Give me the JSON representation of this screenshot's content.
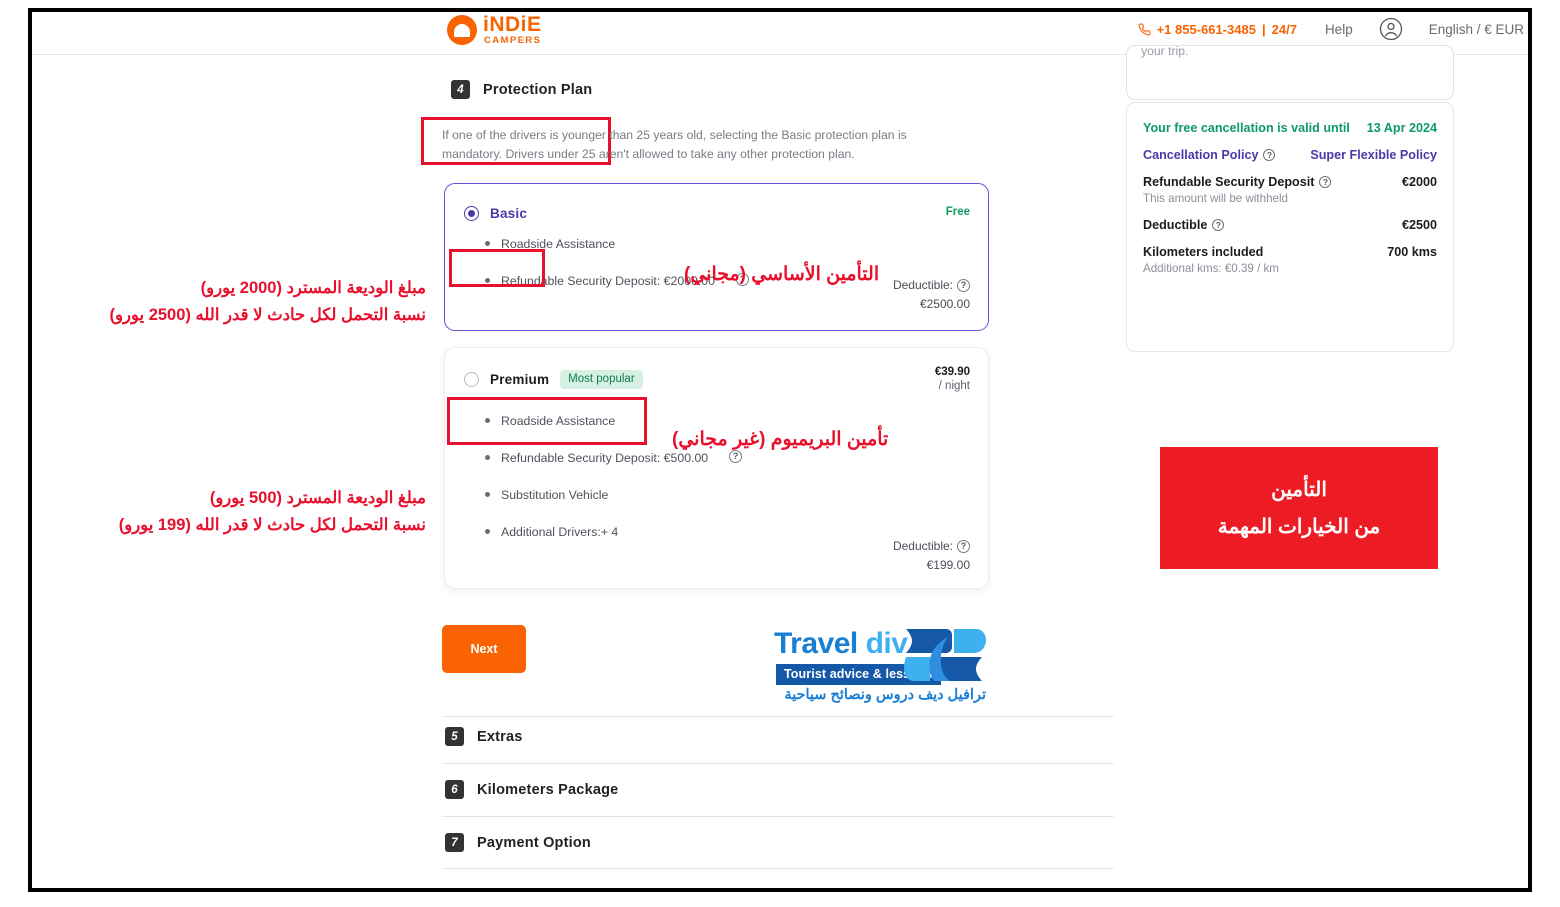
{
  "header": {
    "logo_text": "iNDiE",
    "logo_sub": "CAMPERS",
    "phone": "+1 855-661-3485",
    "phone_sep": "|",
    "phone_hours": "24/7",
    "help": "Help",
    "language": "English / € EUR"
  },
  "protection": {
    "step_number": "4",
    "title": "Protection Plan",
    "description": "If one of the drivers is younger than 25 years old, selecting the Basic protection plan is mandatory. Drivers under 25 aren't allowed to take any other protection plan.",
    "basic": {
      "name": "Basic",
      "price": "Free",
      "features": [
        "Roadside Assistance",
        "Refundable Security Deposit: €2000.00"
      ],
      "deductible_label": "Deductible:",
      "deductible_value": "€2500.00"
    },
    "premium": {
      "name": "Premium",
      "badge": "Most popular",
      "price": "€39.90",
      "price_unit": "/ night",
      "features": [
        "Roadside Assistance",
        "Refundable Security Deposit: €500.00",
        "Substitution Vehicle",
        "Additional Drivers:+ 4"
      ],
      "deductible_label": "Deductible:",
      "deductible_value": "€199.00"
    }
  },
  "next_button": "Next",
  "travel_div": {
    "word_1": "Travel",
    "word_2": "div",
    "tagline": "Tourist advice & lessons",
    "tagline_ar": "ترافيل ديف  دروس ونصائح سياحية"
  },
  "steps": [
    {
      "number": "5",
      "title": "Extras"
    },
    {
      "number": "6",
      "title": "Kilometers Package"
    },
    {
      "number": "7",
      "title": "Payment Option"
    }
  ],
  "sidebar": {
    "partial_text": "your trip.",
    "cancellation_label": "Your free cancellation is valid until",
    "cancellation_date": "13 Apr 2024",
    "policy_label": "Cancellation Policy",
    "policy_value": "Super Flexible Policy",
    "deposit_label": "Refundable Security Deposit",
    "deposit_value": "€2000",
    "deposit_sub": "This amount will be withheld",
    "deductible_label": "Deductible",
    "deductible_value": "€2500",
    "kms_label": "Kilometers included",
    "kms_value": "700 kms",
    "kms_sub": "Additional kms: €0.39 / km"
  },
  "annotations": {
    "basic_title_ar": "التأمين الأساسي (مجاني)",
    "premium_title_ar": "تأمين البريميوم (غير مجاني)",
    "basic_left_line1": "مبلغ الوديعة المسترد (2000 يورو)",
    "basic_left_line2": "نسبة التحمل لكل حادث لا قدر الله (2500 يورو)",
    "premium_left_line1": "مبلغ الوديعة المسترد (500 يورو)",
    "premium_left_line2": "نسبة التحمل لكل حادث لا قدر الله (199 يورو)",
    "redbox_line1": "التأمين",
    "redbox_line2": "من الخيارات المهمة"
  },
  "colors": {
    "brand_orange": "#f96302",
    "accent_purple": "#4a3aa8",
    "green": "#0f9b63",
    "annotation_red": "#e8112d"
  }
}
